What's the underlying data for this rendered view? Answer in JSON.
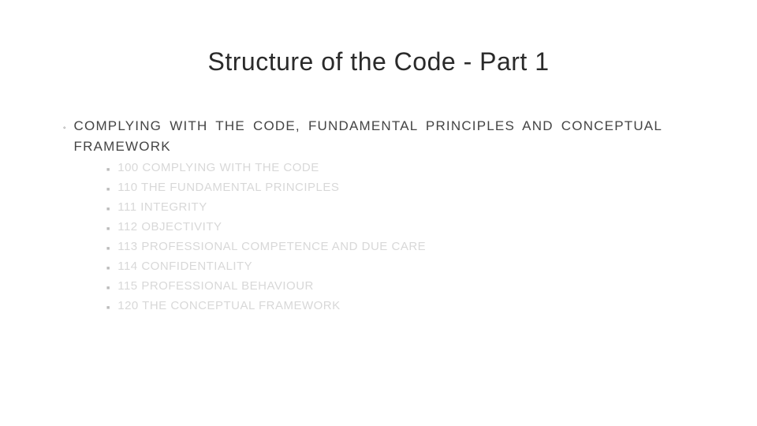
{
  "title": "Structure of the Code - Part 1",
  "main": {
    "label": "COMPLYING WITH THE CODE, FUNDAMENTAL PRINCIPLES AND CONCEPTUAL FRAMEWORK"
  },
  "sub": [
    "100 COMPLYING WITH THE CODE",
    "110 THE FUNDAMENTAL PRINCIPLES",
    "111 INTEGRITY",
    "112 OBJECTIVITY",
    "113 PROFESSIONAL COMPETENCE AND DUE CARE",
    "114 CONFIDENTIALITY",
    "115 PROFESSIONAL BEHAVIOUR",
    "120 THE CONCEPTUAL FRAMEWORK"
  ]
}
